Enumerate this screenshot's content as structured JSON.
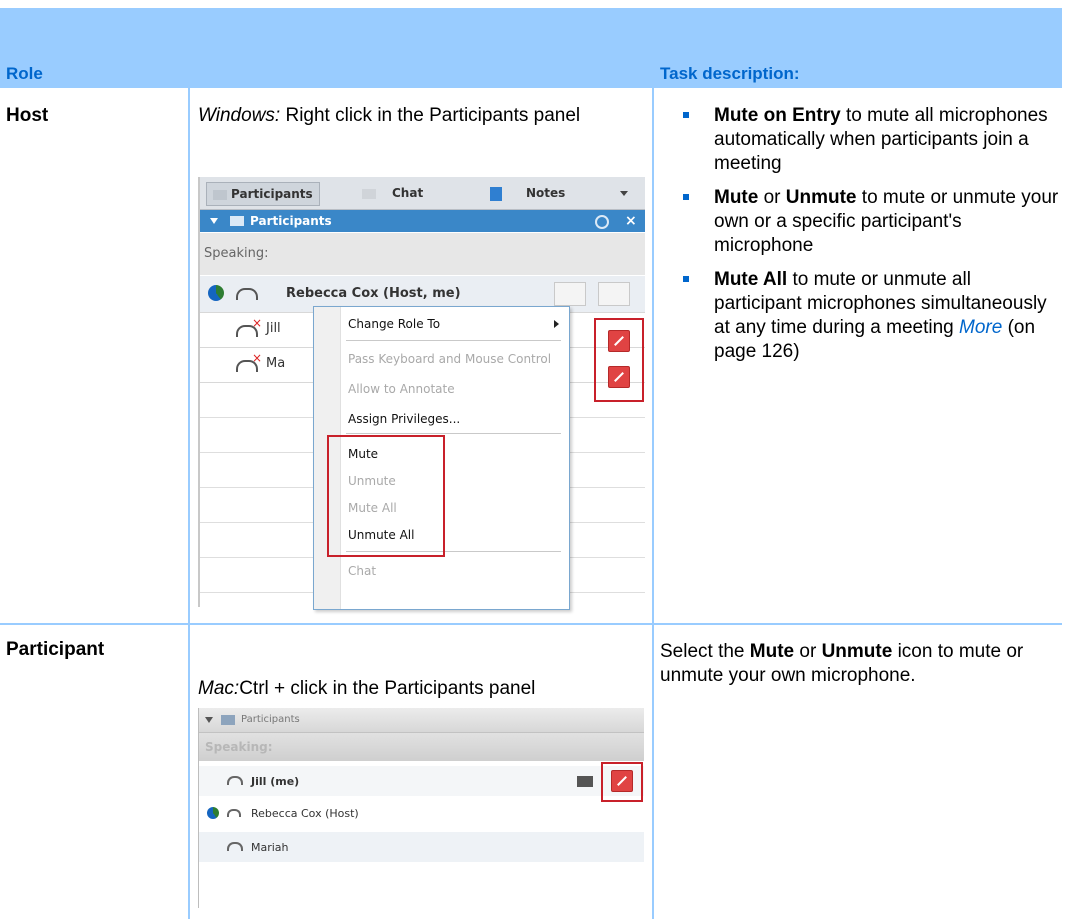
{
  "header": {
    "role": "Role",
    "task": "Task description:"
  },
  "rows": {
    "host": {
      "role": "Host",
      "os_label": "Windows:",
      "instruction": " Right click in the Participants panel",
      "bullets": [
        {
          "bold": "Mute on Entry",
          "text": " to mute all microphones automatically when participants join a meeting"
        },
        {
          "bold1": "Mute",
          "mid": " or ",
          "bold2": "Unmute",
          "text": " to mute or unmute your own or a specific participant's microphone"
        },
        {
          "bold": "Mute All",
          "text": " to mute or unmute all participant microphones simultaneously at any time during a meeting ",
          "link": "More",
          "tail": " (on page 126)"
        }
      ]
    },
    "participant": {
      "role": "Participant",
      "os_label": "Mac:",
      "instruction": "Ctrl + click in the Participants panel",
      "desc_pre": "Select the ",
      "desc_b1": "Mute",
      "desc_mid": " or ",
      "desc_b2": "Unmute",
      "desc_post": " icon to mute or unmute your own microphone."
    }
  },
  "win_ui": {
    "tabs": [
      "Participants",
      "Chat",
      "Notes"
    ],
    "panel_title": "Participants",
    "speaking": "Speaking:",
    "participants": [
      "Rebecca Cox (Host, me)",
      "Jill",
      "Ma"
    ],
    "menu": [
      {
        "label": "Change Role To",
        "disabled": false
      },
      {
        "label": "Pass Keyboard and Mouse Control",
        "disabled": true
      },
      {
        "label": "Allow to Annotate",
        "disabled": true
      },
      {
        "label": "Assign Privileges...",
        "disabled": false
      },
      {
        "label": "Mute",
        "disabled": false
      },
      {
        "label": "Unmute",
        "disabled": true
      },
      {
        "label": "Mute All",
        "disabled": true
      },
      {
        "label": "Unmute All",
        "disabled": false
      },
      {
        "label": "Chat",
        "disabled": true
      }
    ],
    "accent": "#3a87c8",
    "highlight": "#c8202a"
  },
  "mac_ui": {
    "panel_title": "Participants",
    "speaking": "Speaking:",
    "participants": [
      "Jill (me)",
      "Rebecca Cox (Host)",
      "Mariah"
    ]
  }
}
